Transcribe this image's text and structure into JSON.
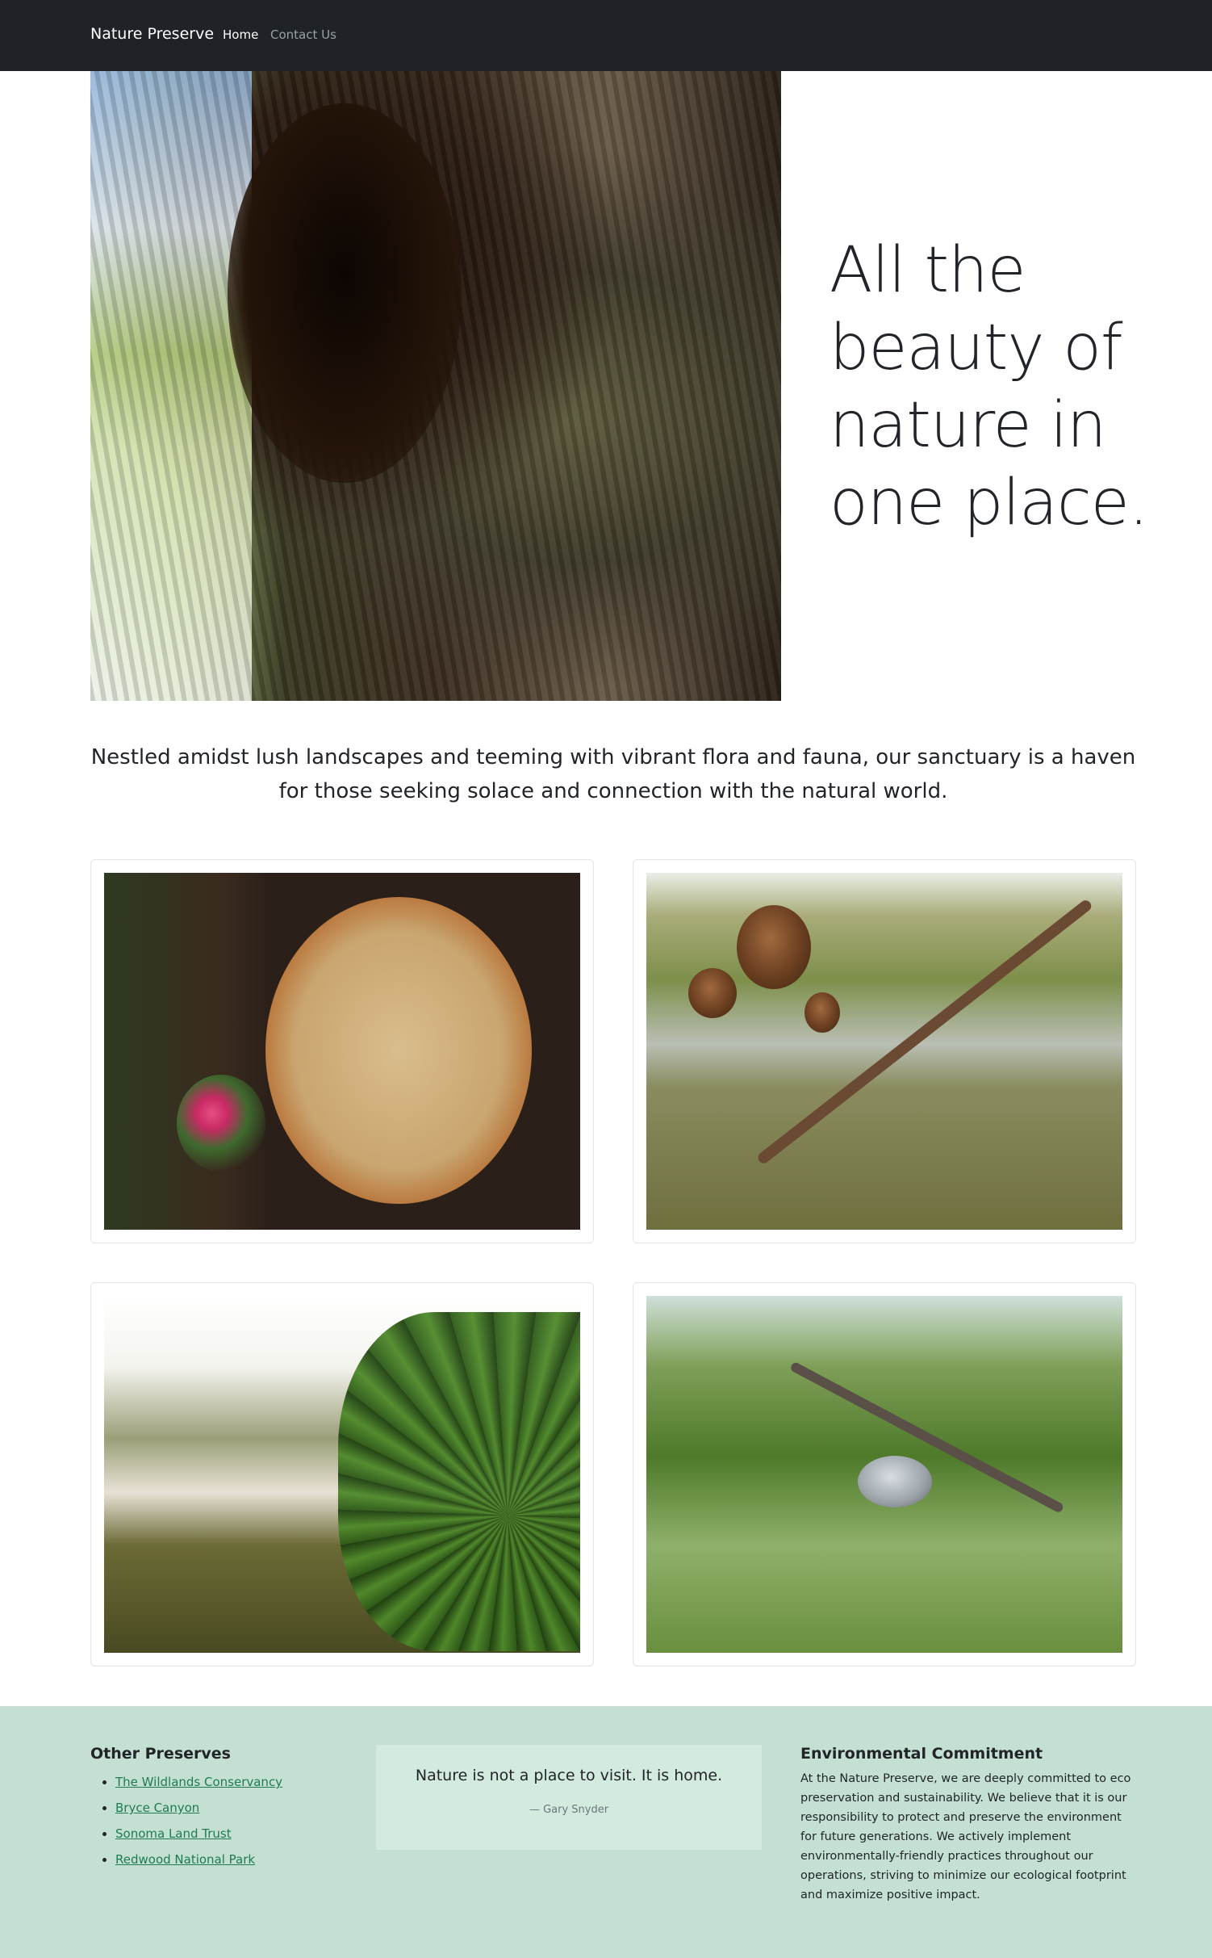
{
  "navbar": {
    "brand": "Nature Preserve",
    "links": [
      {
        "label": "Home"
      },
      {
        "label": "Contact Us"
      }
    ]
  },
  "hero": {
    "title": "All the beauty of nature in one place."
  },
  "intro": {
    "text": "Nestled amidst lush landscapes and teeming with vibrant flora and fauna, our sanctuary is a haven for those seeking solace and connection with the natural world."
  },
  "footer": {
    "other_preserves": {
      "heading": "Other Preserves",
      "links": [
        "The Wildlands Conservancy",
        "Bryce Canyon",
        "Sonoma Land Trust",
        "Redwood National Park"
      ]
    },
    "quote": {
      "text": "Nature is not a place to visit. It is home.",
      "author": "— Gary Snyder"
    },
    "commitment": {
      "heading": "Environmental Commitment",
      "text": "At the Nature Preserve, we are deeply committed to eco preservation and sustainability. We believe that it is our responsibility to protect and preserve the environment for future generations. We actively implement environmentally-friendly practices throughout our operations, striving to minimize our ecological footprint and maximize positive impact."
    }
  }
}
